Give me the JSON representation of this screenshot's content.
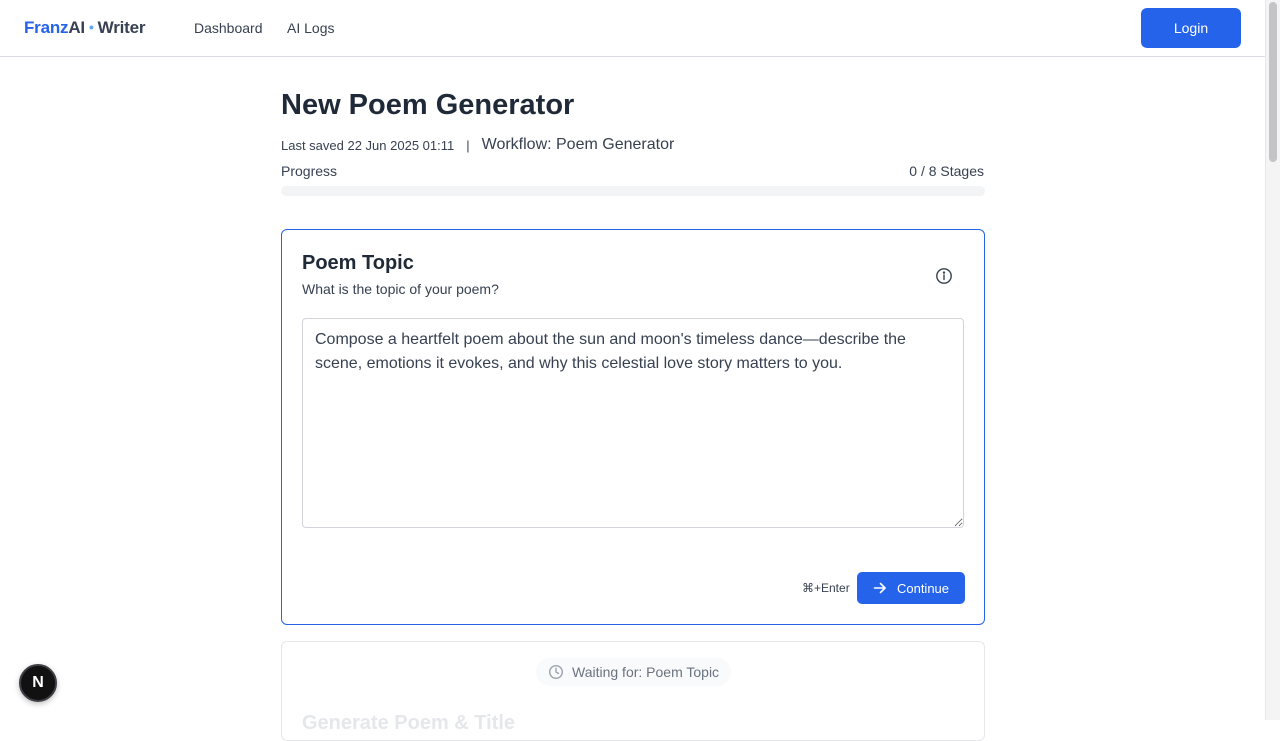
{
  "brand": {
    "part1": "Franz",
    "part2": "AI",
    "separator": "•",
    "part3": "Writer"
  },
  "nav": {
    "items": [
      {
        "label": "Dashboard"
      },
      {
        "label": "AI Logs"
      }
    ],
    "login_label": "Login"
  },
  "page": {
    "title": "New Poem Generator",
    "last_saved": "Last saved 22 Jun 2025 01:11",
    "separator": "|",
    "workflow": "Workflow: Poem Generator",
    "progress_label": "Progress",
    "progress_count": "0 / 8 Stages",
    "progress_fraction": 0
  },
  "stage": {
    "title": "Poem Topic",
    "subtitle": "What is the topic of your poem?",
    "input_value": "Compose a heartfelt poem about the sun and moon's timeless dance—describe the scene, emotions it evokes, and why this celestial love story matters to you.",
    "shortcut": "⌘+Enter",
    "continue_label": "Continue",
    "info_icon": "info-icon",
    "continue_icon": "arrow-right-icon"
  },
  "next_stage": {
    "waiting_text": "Waiting for: Poem Topic",
    "title_partial": "Generate Poem & Title",
    "icon": "clock-icon"
  },
  "badge": {
    "label": "N"
  },
  "colors": {
    "accent": "#2563eb",
    "badge_bg": "#111111"
  }
}
